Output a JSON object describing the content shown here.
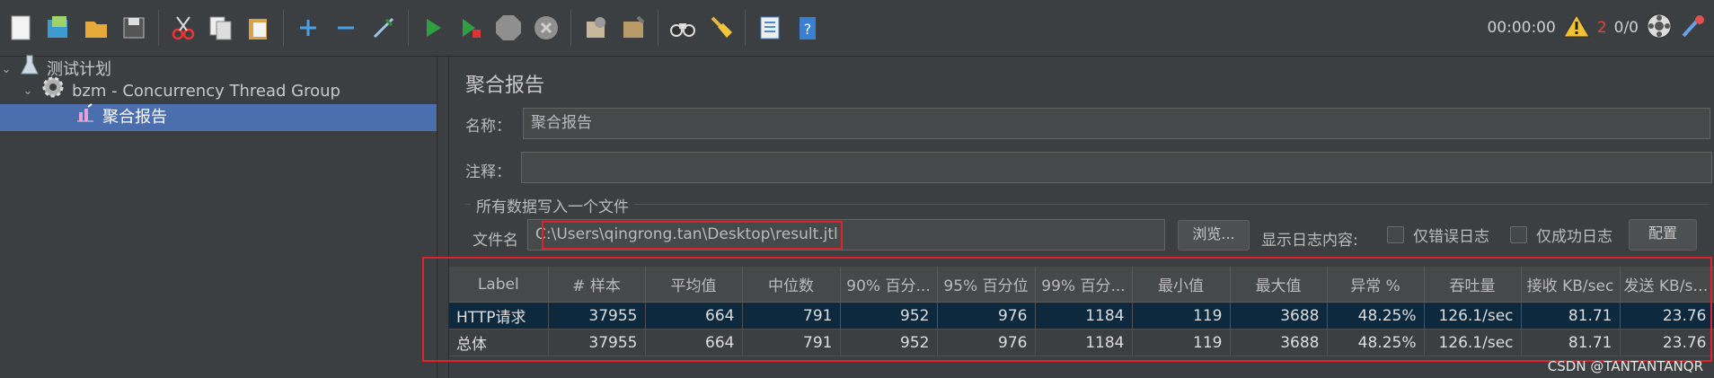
{
  "toolbar": {
    "icons": [
      "new-icon",
      "templates-icon",
      "open-icon",
      "save-icon",
      "cut-icon",
      "copy-icon",
      "paste-icon",
      "expand-icon",
      "collapse-icon",
      "toggle-icon",
      "start-icon",
      "start-no-pause-icon",
      "stop-icon",
      "shutdown-icon",
      "clear-icon",
      "clear-all-icon",
      "search-icon",
      "reset-search-icon",
      "function-helper-icon",
      "help-icon"
    ],
    "timer": "00:00:00",
    "error_count": "2",
    "thread_count": "0/0"
  },
  "tree": {
    "items": [
      {
        "label": "测试计划"
      },
      {
        "label": "bzm - Concurrency Thread Group"
      },
      {
        "label": "聚合报告"
      }
    ]
  },
  "panel": {
    "title": "聚合报告",
    "name_label": "名称：",
    "name_value": "聚合报告",
    "comment_label": "注释：",
    "comment_value": "",
    "group_title": "所有数据写入一个文件",
    "filename_label": "文件名",
    "filename_value": "C:\\Users\\qingrong.tan\\Desktop\\result.jtl",
    "browse_label": "浏览...",
    "log_label": "显示日志内容:",
    "errors_only_label": "仅错误日志",
    "success_only_label": "仅成功日志",
    "config_label": "配置"
  },
  "table": {
    "headers": [
      "Label",
      "# 样本",
      "平均值",
      "中位数",
      "90% 百分...",
      "95% 百分位",
      "99% 百分...",
      "最小值",
      "最大值",
      "异常 %",
      "吞吐量",
      "接收 KB/sec",
      "发送 KB/sec"
    ],
    "rows": [
      [
        "HTTP请求",
        "37955",
        "664",
        "791",
        "952",
        "976",
        "1184",
        "119",
        "3688",
        "48.25%",
        "126.1/sec",
        "81.71",
        "23.76"
      ],
      [
        "总体",
        "37955",
        "664",
        "791",
        "952",
        "976",
        "1184",
        "119",
        "3688",
        "48.25%",
        "126.1/sec",
        "81.71",
        "23.76"
      ]
    ]
  },
  "watermark": "CSDN @TANTANTANQR",
  "colors": {
    "accent": "#4b6eaf",
    "highlight_box": "#e0232b",
    "row_selected": "#0d293e"
  }
}
